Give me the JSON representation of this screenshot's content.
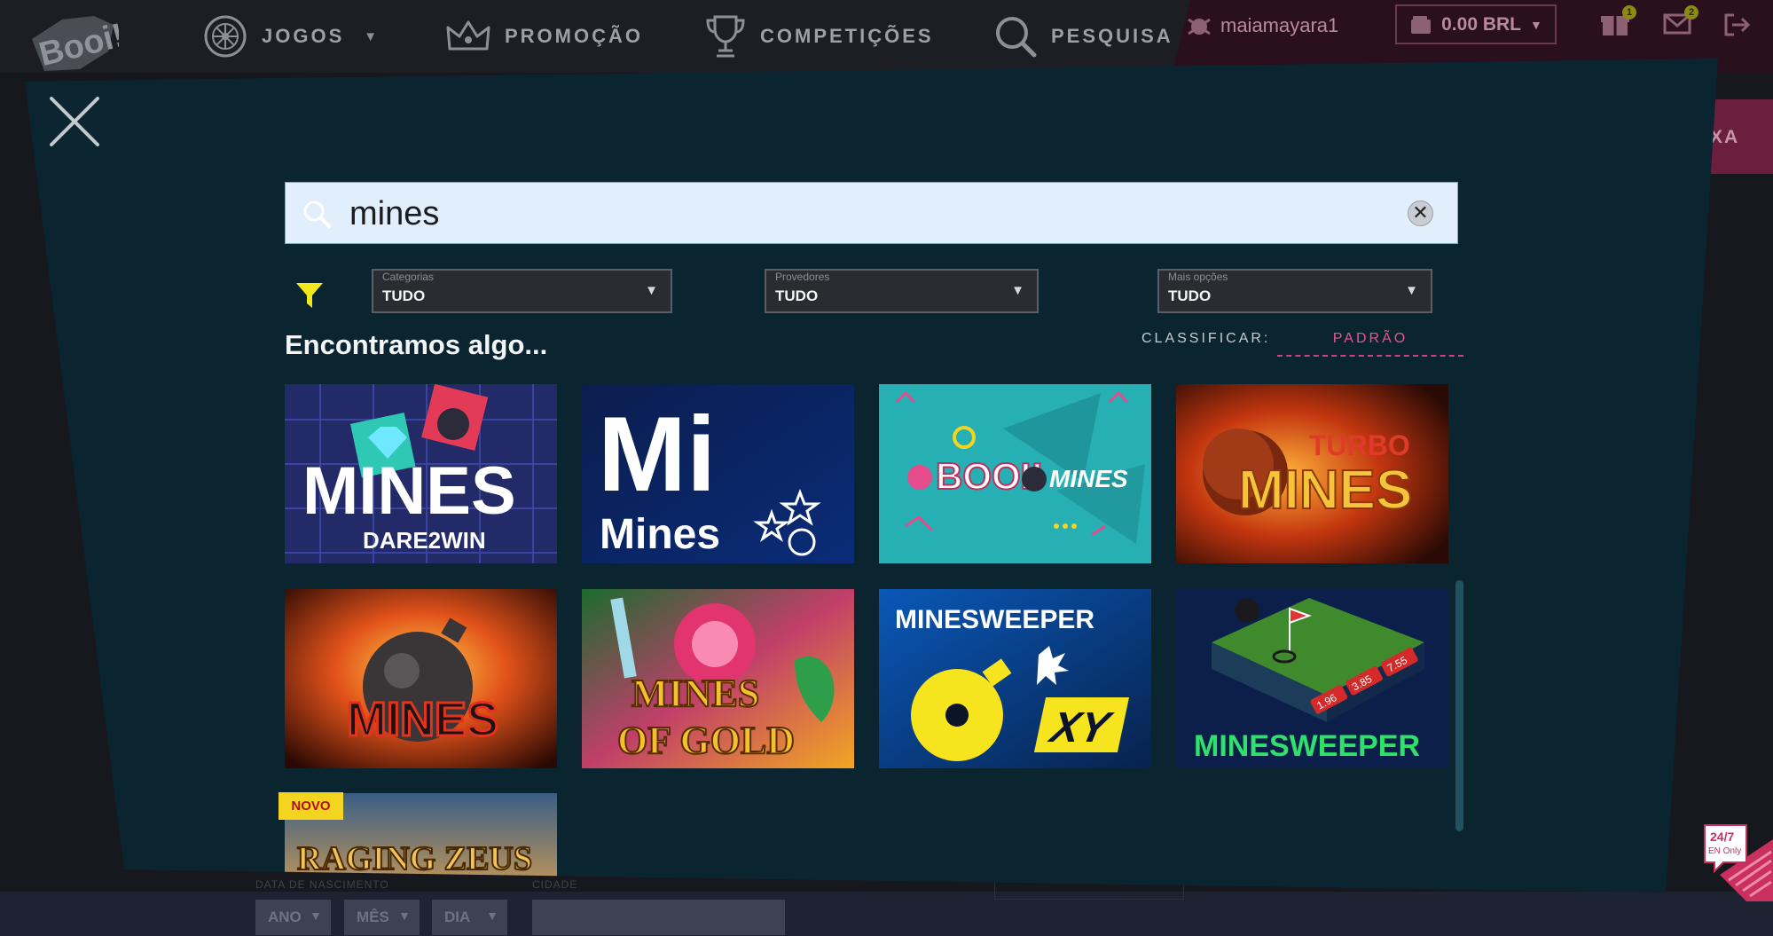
{
  "nav": {
    "jogos": "JOGOS",
    "promocao": "PROMOÇÃO",
    "competicoes": "COMPETIÇÕES",
    "pesquisa": "PESQUISA"
  },
  "account": {
    "username": "maiamayara1",
    "balance": "0.00 BRL",
    "gift_count": "1",
    "mail_count": "2",
    "side_tab": "XA"
  },
  "search": {
    "query": "mines"
  },
  "filters": [
    {
      "label": "Categorias",
      "value": "TUDO"
    },
    {
      "label": "Provedores",
      "value": "TUDO"
    },
    {
      "label": "Mais opções",
      "value": "TUDO"
    }
  ],
  "results": {
    "heading": "Encontramos algo...",
    "sort_label": "CLASSIFICAR:",
    "sort_value": "PADRÃO",
    "new_badge": "NOVO",
    "games": [
      {
        "title": "MINES",
        "subtitle": "DARE2WIN"
      },
      {
        "title": "Mi",
        "subtitle": "Mines"
      },
      {
        "title": "BOOI!",
        "subtitle": "MINES"
      },
      {
        "title": "TURBO",
        "subtitle": "MINES"
      },
      {
        "title": "MINES"
      },
      {
        "title": "MINES",
        "subtitle": "OF GOLD"
      },
      {
        "title": "MINESWEEPER",
        "subtitle": "XY"
      },
      {
        "title": "MINESWEEPER",
        "multipliers": [
          "1.96",
          "3.85",
          "7.55"
        ]
      },
      {
        "title": "RAGING ZEUS"
      }
    ]
  },
  "background_form": {
    "birth_label": "DATA DE NASCIMENTO",
    "city_label": "CIDADE",
    "year": "ANO",
    "month": "MÊS",
    "day": "DIA"
  },
  "support": {
    "hours": "24/7",
    "lang": "EN Only"
  },
  "colors": {
    "modal_bg": "#0b2530",
    "accent_pink": "#e65591",
    "filter_yellow": "#f3e81c",
    "new_badge": "#f3d51f"
  }
}
